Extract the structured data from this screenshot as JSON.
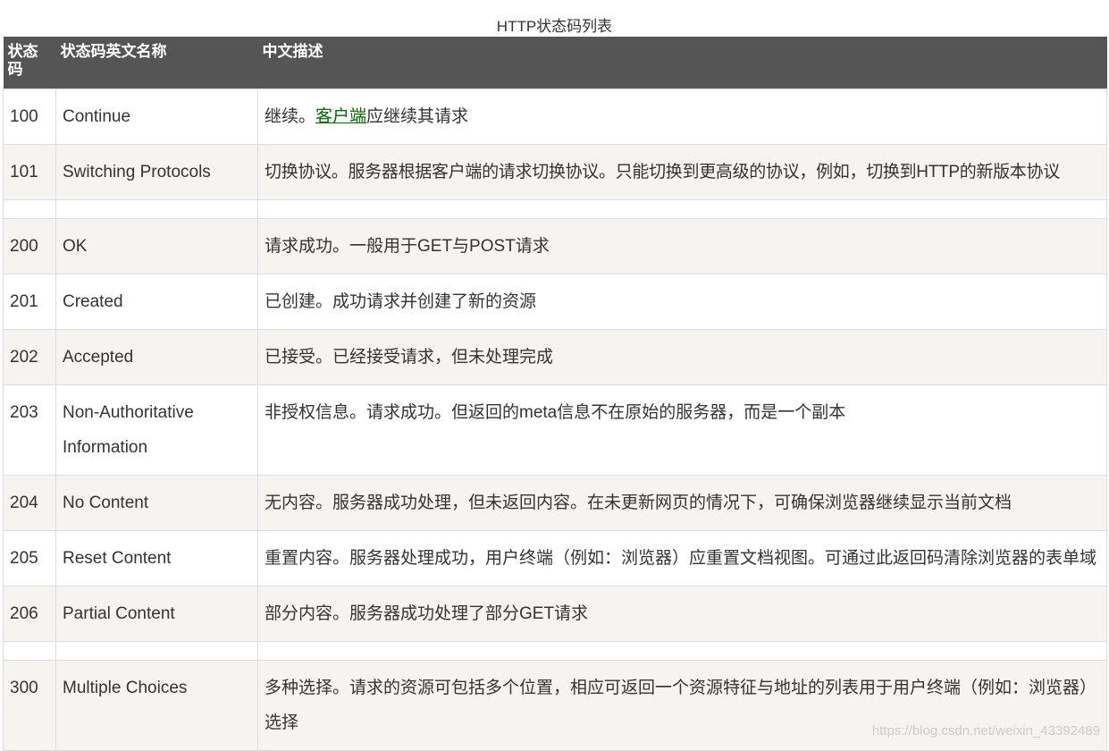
{
  "caption": "HTTP状态码列表",
  "headers": {
    "code": "状态码",
    "name": "状态码英文名称",
    "desc": "中文描述"
  },
  "rows": [
    {
      "code": "100",
      "name": "Continue",
      "desc_pre": "继续。",
      "desc_link": "客户端",
      "desc_post": "应继续其请求"
    },
    {
      "code": "101",
      "name": "Switching Protocols",
      "desc": "切换协议。服务器根据客户端的请求切换协议。只能切换到更高级的协议，例如，切换到HTTP的新版本协议"
    },
    {
      "code": "200",
      "name": "OK",
      "desc": "请求成功。一般用于GET与POST请求"
    },
    {
      "code": "201",
      "name": "Created",
      "desc": "已创建。成功请求并创建了新的资源"
    },
    {
      "code": "202",
      "name": "Accepted",
      "desc": "已接受。已经接受请求，但未处理完成"
    },
    {
      "code": "203",
      "name": "Non-Authoritative Information",
      "desc": "非授权信息。请求成功。但返回的meta信息不在原始的服务器，而是一个副本"
    },
    {
      "code": "204",
      "name": "No Content",
      "desc": "无内容。服务器成功处理，但未返回内容。在未更新网页的情况下，可确保浏览器继续显示当前文档"
    },
    {
      "code": "205",
      "name": "Reset Content",
      "desc": "重置内容。服务器处理成功，用户终端（例如：浏览器）应重置文档视图。可通过此返回码清除浏览器的表单域"
    },
    {
      "code": "206",
      "name": "Partial Content",
      "desc": "部分内容。服务器成功处理了部分GET请求"
    },
    {
      "code": "300",
      "name": "Multiple Choices",
      "desc": "多种选择。请求的资源可包括多个位置，相应可返回一个资源特征与地址的列表用于用户终端（例如：浏览器）选择"
    }
  ],
  "watermark": "https://blog.csdn.net/weixin_43392489"
}
